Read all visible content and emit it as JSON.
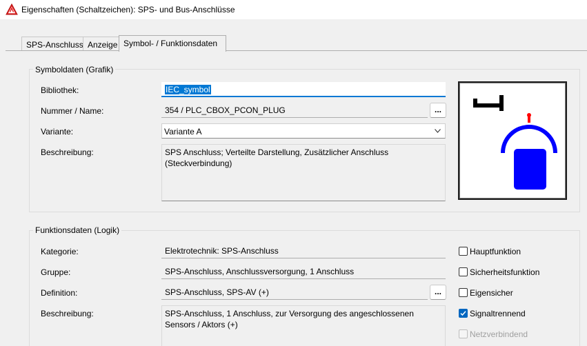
{
  "window": {
    "title": "Eigenschaften (Schaltzeichen): SPS- und Bus-Anschlüsse"
  },
  "tabs": [
    {
      "label": "SPS-Anschluss"
    },
    {
      "label": "Anzeige"
    },
    {
      "label": "Symbol- / Funktionsdaten"
    }
  ],
  "symbol_group": {
    "title": "Symboldaten (Grafik)",
    "library_label": "Bibliothek:",
    "library_value": "IEC_symbol",
    "number_label": "Nummer / Name:",
    "number_value": "354 / PLC_CBOX_PCON_PLUG",
    "number_browse": "...",
    "variant_label": "Variante:",
    "variant_value": "Variante A",
    "description_label": "Beschreibung:",
    "description_value": "SPS Anschluss; Verteilte Darstellung, Zusätzlicher Anschluss (Steckverbindung)"
  },
  "function_group": {
    "title": "Funktionsdaten (Logik)",
    "category_label": "Kategorie:",
    "category_value": "Elektrotechnik: SPS-Anschluss",
    "group_label": "Gruppe:",
    "group_value": "SPS-Anschluss, Anschlussversorgung, 1 Anschluss",
    "definition_label": "Definition:",
    "definition_value": "SPS-Anschluss, SPS-AV (+)",
    "definition_browse": "...",
    "description_label": "Beschreibung:",
    "description_value": "SPS-Anschluss, 1 Anschluss, zur Versorgung des angeschlossenen Sensors / Aktors (+)",
    "checkboxes": [
      {
        "label": "Hauptfunktion",
        "checked": false,
        "enabled": true
      },
      {
        "label": "Sicherheitsfunktion",
        "checked": false,
        "enabled": true
      },
      {
        "label": "Eigensicher",
        "checked": false,
        "enabled": true
      },
      {
        "label": "Signaltrennend",
        "checked": true,
        "enabled": true
      },
      {
        "label": "Netzverbindend",
        "checked": false,
        "enabled": false
      }
    ]
  },
  "colors": {
    "accent": "#0078d4",
    "symbol_blue": "#0000ff",
    "symbol_red": "#ff0000",
    "app_icon_red": "#e02020"
  },
  "icons": {
    "app": "warning-triangle-icon",
    "combo": "chevron-down-icon",
    "checkbox_checked": "checkmark-icon"
  }
}
